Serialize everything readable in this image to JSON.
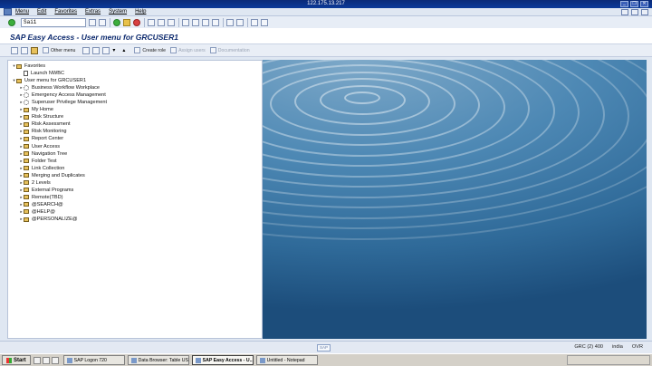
{
  "window": {
    "title": "122.175.13.217",
    "controls": [
      "minimize-icon",
      "restore-icon",
      "close-icon"
    ]
  },
  "menubar": {
    "items": [
      "Menu",
      "Edit",
      "Favorites",
      "Extras",
      "System",
      "Help"
    ]
  },
  "std_toolbar": {
    "command_value": "Sai1"
  },
  "screen": {
    "title": "SAP Easy Access  -  User menu for GRCUSER1"
  },
  "app_toolbar": {
    "other_menu": "Other menu",
    "create_role": "Create role",
    "assign_users": "Assign users",
    "documentation": "Documentation"
  },
  "tree": {
    "rows": [
      {
        "label": "Favorites",
        "indent": 0,
        "toggle": "▾",
        "icon": "folder"
      },
      {
        "label": "Launch NWBC",
        "indent": 1,
        "toggle": "",
        "icon": "doc"
      },
      {
        "label": "User menu for GRCUSER1",
        "indent": 0,
        "toggle": "▾",
        "icon": "folder"
      },
      {
        "label": "Business Workflow Workplace",
        "indent": 1,
        "toggle": "▸",
        "icon": "gear"
      },
      {
        "label": "Emergency Access Management",
        "indent": 1,
        "toggle": "▸",
        "icon": "gear"
      },
      {
        "label": "Superuser Privilege Management",
        "indent": 1,
        "toggle": "▸",
        "icon": "gear"
      },
      {
        "label": "My Home",
        "indent": 1,
        "toggle": "▸",
        "icon": "folder"
      },
      {
        "label": "Risk Structure",
        "indent": 1,
        "toggle": "▸",
        "icon": "folder"
      },
      {
        "label": "Risk Assessment",
        "indent": 1,
        "toggle": "▸",
        "icon": "folder"
      },
      {
        "label": "Risk Monitoring",
        "indent": 1,
        "toggle": "▸",
        "icon": "folder"
      },
      {
        "label": "Report Center",
        "indent": 1,
        "toggle": "▸",
        "icon": "folder"
      },
      {
        "label": "User Access",
        "indent": 1,
        "toggle": "▸",
        "icon": "folder"
      },
      {
        "label": "Navigation Tree",
        "indent": 1,
        "toggle": "▸",
        "icon": "folder"
      },
      {
        "label": "Folder Test",
        "indent": 1,
        "toggle": "▸",
        "icon": "folder"
      },
      {
        "label": "Link Collection",
        "indent": 1,
        "toggle": "▸",
        "icon": "folder"
      },
      {
        "label": "Merging and Duplicates",
        "indent": 1,
        "toggle": "▸",
        "icon": "folder"
      },
      {
        "label": "2 Levels",
        "indent": 1,
        "toggle": "▸",
        "icon": "folder"
      },
      {
        "label": "External Programs",
        "indent": 1,
        "toggle": "▸",
        "icon": "folder"
      },
      {
        "label": "Remote(TBD)",
        "indent": 1,
        "toggle": "▸",
        "icon": "folder"
      },
      {
        "label": "@SEARCH@",
        "indent": 1,
        "toggle": "▸",
        "icon": "folder"
      },
      {
        "label": "@HELP@",
        "indent": 1,
        "toggle": "▸",
        "icon": "folder"
      },
      {
        "label": "@PERSONALIZE@",
        "indent": 1,
        "toggle": "▸",
        "icon": "folder"
      }
    ]
  },
  "statusbar": {
    "sap_logo": "SAP",
    "system": "GRC (2) 400",
    "server": "india",
    "mode": "OVR"
  },
  "taskbar": {
    "start": "Start",
    "tasks": [
      {
        "label": "SAP Logon 720",
        "active": false
      },
      {
        "label": "Data Browser: Table US...",
        "active": false
      },
      {
        "label": "SAP Easy Access - U...",
        "active": true
      },
      {
        "label": "Untitled - Notepad",
        "active": false
      }
    ]
  }
}
